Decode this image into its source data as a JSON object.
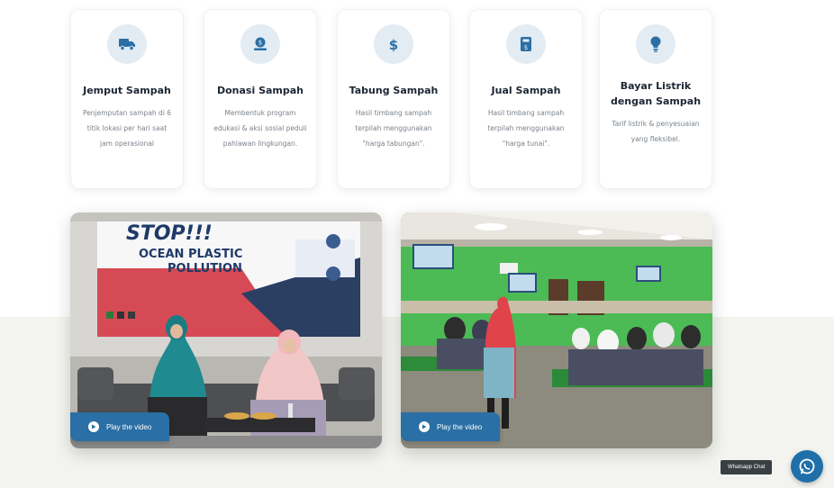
{
  "services": [
    {
      "icon": "truck-icon",
      "title": "Jemput Sampah",
      "desc": "Penjemputan sampah di 6 titik lokasi per hari saat jam operasional"
    },
    {
      "icon": "donation-icon",
      "title": "Donasi Sampah",
      "desc": "Membentuk program edukasi & aksi sosial peduli pahlawan lingkungan."
    },
    {
      "icon": "dollar-icon",
      "title": "Tabung Sampah",
      "desc": "Hasil timbang sampah terpilah menggunakan \"harga tabungan\"."
    },
    {
      "icon": "wallet-icon",
      "title": "Jual Sampah",
      "desc": "Hasil timbang sampah terpilah menggunakan \"harga tunai\"."
    },
    {
      "icon": "lightbulb-icon",
      "title": "Bayar Listrik dengan Sampah",
      "desc": "Tarif listrik & penyesuaian yang fleksibel."
    }
  ],
  "videos": [
    {
      "play_label": "Play the video",
      "banner_title_1": "STOP!!!",
      "banner_title_2": "OCEAN PLASTIC",
      "banner_title_3": "POLLUTION"
    },
    {
      "play_label": "Play the video"
    }
  ],
  "whatsapp": {
    "label": "Whatsapp Chat",
    "icon": "whatsapp-icon"
  },
  "colors": {
    "accent": "#2a6fa5",
    "icon_circle": "#e3ebf3",
    "wall_green": "#4cbb55"
  }
}
